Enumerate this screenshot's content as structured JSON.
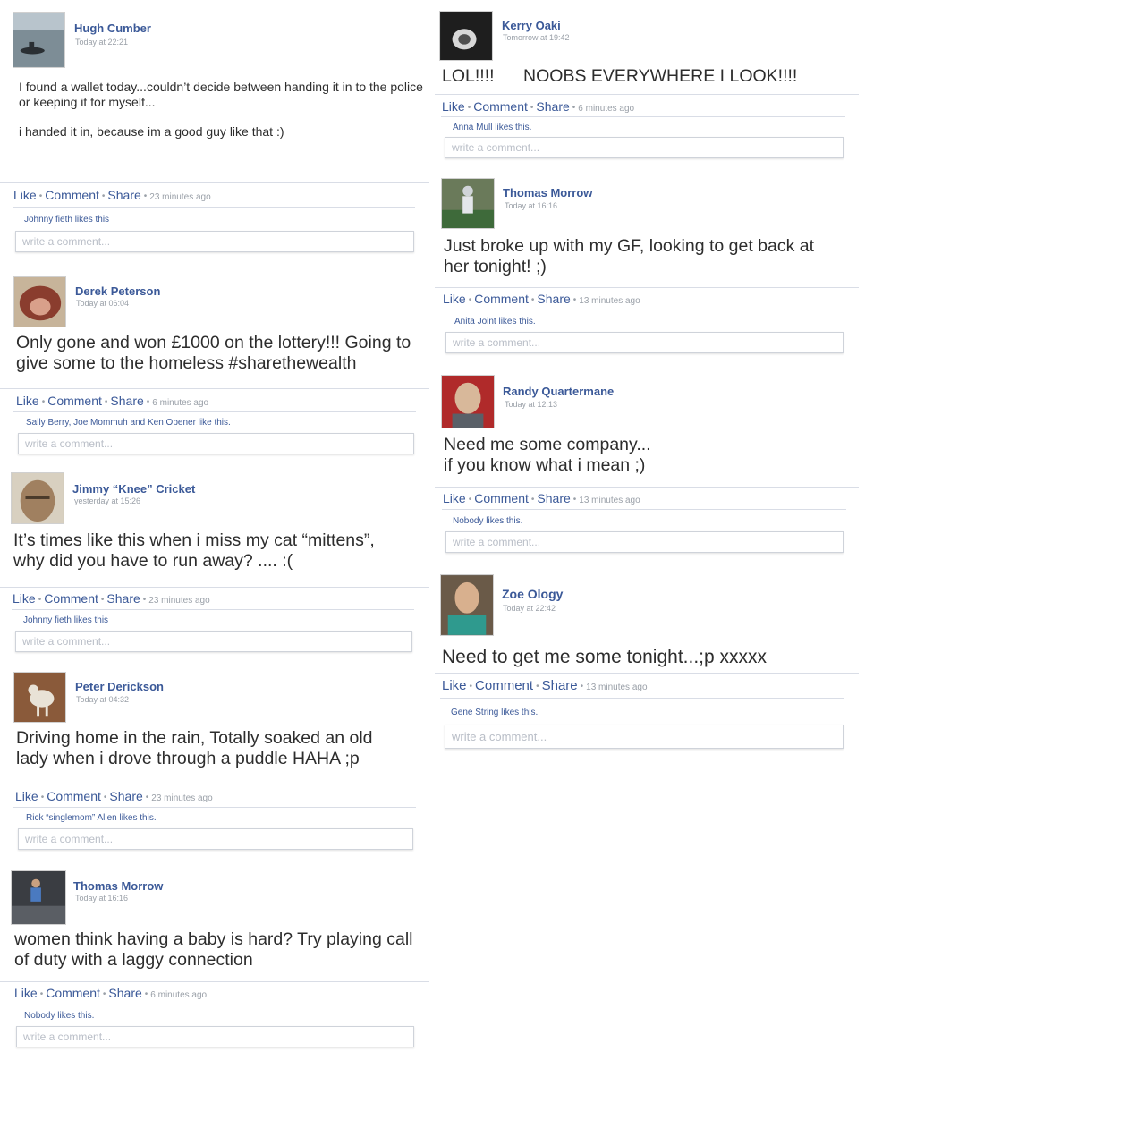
{
  "posts": [
    {
      "name": "Hugh Cumber",
      "time": "Today at 22:21",
      "message": "I found a wallet today...couldn’t decide between handing it in to the police or keeping it for myself...\n\ni handed it in, because im a good guy like that :)",
      "actions": {
        "like": "Like",
        "comment": "Comment",
        "share": "Share",
        "ago": "23 minutes ago"
      },
      "likes": "Johnny fieth likes this",
      "placeholder": "write a comment..."
    },
    {
      "name": "Derek Peterson",
      "time": "Today at 06:04",
      "message": "Only gone and won £1000 on the lottery!!! Going to give some to the homeless #sharethewealth",
      "actions": {
        "like": "Like",
        "comment": "Comment",
        "share": "Share",
        "ago": "6 minutes ago"
      },
      "likes": "Sally Berry, Joe Mommuh and Ken Opener like this.",
      "placeholder": "write a comment..."
    },
    {
      "name": "Jimmy “Knee” Cricket",
      "time": "yesterday at 15:26",
      "message": "It’s times like this when i miss my cat “mittens”, why did you have to run away? .... :(",
      "actions": {
        "like": "Like",
        "comment": "Comment",
        "share": "Share",
        "ago": "23 minutes ago"
      },
      "likes": "Johnny fieth likes this",
      "placeholder": "write a comment..."
    },
    {
      "name": "Peter Derickson",
      "time": "Today at 04:32",
      "message": "Driving home in the rain, Totally soaked an old lady when i drove through a puddle HAHA ;p",
      "actions": {
        "like": "Like",
        "comment": "Comment",
        "share": "Share",
        "ago": "23 minutes ago"
      },
      "likes": "Rick “singlemom” Allen likes this.",
      "placeholder": "write a comment..."
    },
    {
      "name": "Thomas Morrow",
      "time": "Today at 16:16",
      "message": "women think having a baby is hard? Try playing call of duty with a laggy connection",
      "actions": {
        "like": "Like",
        "comment": "Comment",
        "share": "Share",
        "ago": "6 minutes ago"
      },
      "likes": "Nobody likes this.",
      "placeholder": "write a comment..."
    },
    {
      "name": "Kerry Oaki",
      "time": "Tomorrow at 19:42",
      "message": "LOL!!!!      NOOBS EVERYWHERE I LOOK!!!!",
      "actions": {
        "like": "Like",
        "comment": "Comment",
        "share": "Share",
        "ago": "6 minutes ago"
      },
      "likes": "Anna Mull likes this.",
      "placeholder": "write a comment..."
    },
    {
      "name": "Thomas Morrow",
      "time": "Today at 16:16",
      "message": "Just broke up with my GF, looking to get back at her tonight! ;)",
      "actions": {
        "like": "Like",
        "comment": "Comment",
        "share": "Share",
        "ago": "13 minutes ago"
      },
      "likes": "Anita Joint likes this.",
      "placeholder": "write a comment..."
    },
    {
      "name": "Randy Quartermane",
      "time": "Today at 12:13",
      "message": "Need me some company...\nif you know what i mean ;)",
      "actions": {
        "like": "Like",
        "comment": "Comment",
        "share": "Share",
        "ago": "13 minutes ago"
      },
      "likes": "Nobody likes this.",
      "placeholder": "write a comment..."
    },
    {
      "name": "Zoe Ology",
      "time": "Today at 22:42",
      "message": "Need to get me some tonight...;p xxxxx",
      "actions": {
        "like": "Like",
        "comment": "Comment",
        "share": "Share",
        "ago": "13 minutes ago"
      },
      "likes": "Gene String likes this.",
      "placeholder": "write a comment..."
    }
  ]
}
